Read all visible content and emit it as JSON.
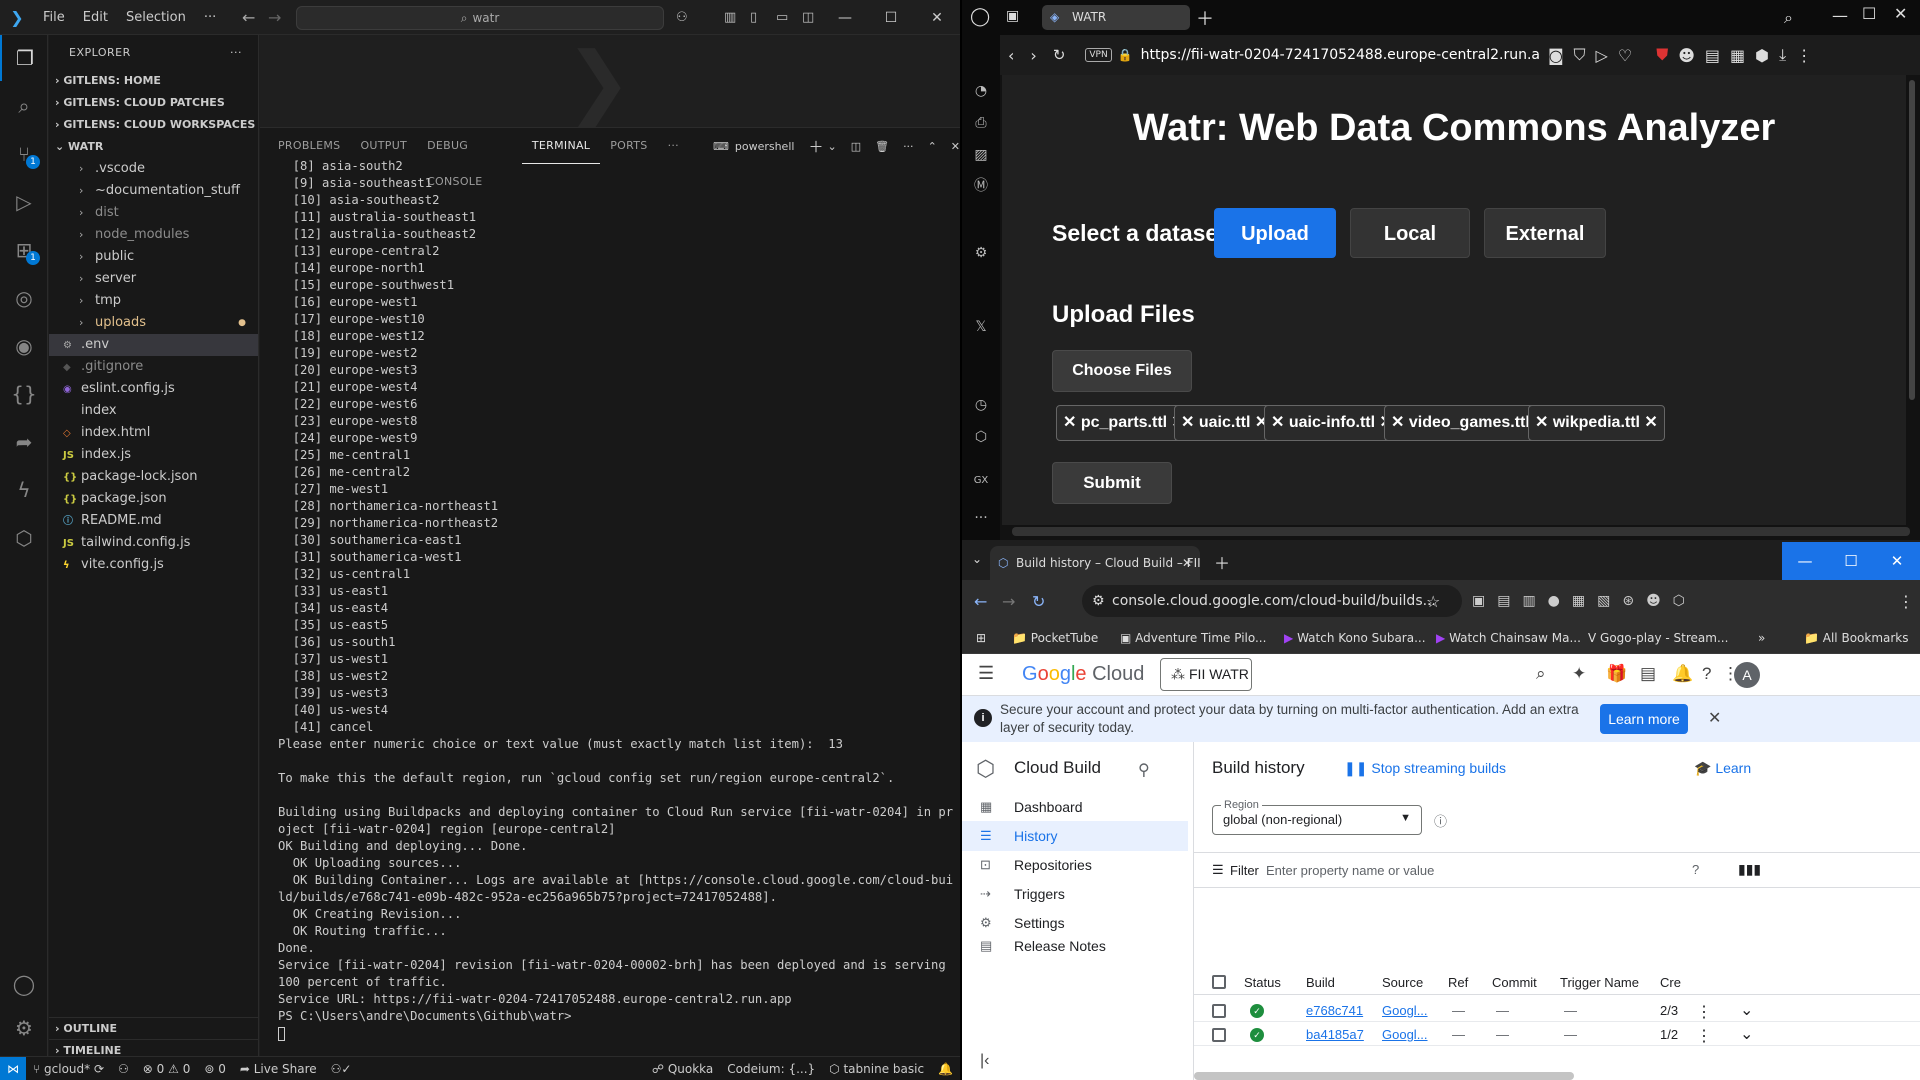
{
  "vscode": {
    "menu": [
      "File",
      "Edit",
      "Selection",
      "···"
    ],
    "search_text": "watr",
    "explorer_title": "EXPLORER",
    "sections": [
      "GITLENS: HOME",
      "GITLENS: CLOUD PATCHES",
      "GITLENS: CLOUD WORKSPACES"
    ],
    "root": "WATR",
    "files": [
      {
        "name": ".vscode",
        "folder": true
      },
      {
        "name": "~documentation_stuff",
        "folder": true
      },
      {
        "name": "dist",
        "folder": true,
        "dim": true
      },
      {
        "name": "node_modules",
        "folder": true,
        "dim": true
      },
      {
        "name": "public",
        "folder": true
      },
      {
        "name": "server",
        "folder": true
      },
      {
        "name": "tmp",
        "folder": true
      },
      {
        "name": "uploads",
        "folder": true,
        "modified": true
      },
      {
        "name": ".env",
        "icon": "gear",
        "selected": true
      },
      {
        "name": ".gitignore",
        "icon": "dot",
        "dim": true
      },
      {
        "name": "eslint.config.js",
        "icon": "eslint"
      },
      {
        "name": "index",
        "icon": "none"
      },
      {
        "name": "index.html",
        "icon": "html"
      },
      {
        "name": "index.js",
        "icon": "js"
      },
      {
        "name": "package-lock.json",
        "icon": "json"
      },
      {
        "name": "package.json",
        "icon": "json"
      },
      {
        "name": "README.md",
        "icon": "md"
      },
      {
        "name": "tailwind.config.js",
        "icon": "js"
      },
      {
        "name": "vite.config.js",
        "icon": "vite"
      }
    ],
    "bottom_sections": [
      "OUTLINE",
      "TIMELINE"
    ],
    "panel_tabs": [
      "PROBLEMS",
      "OUTPUT",
      "DEBUG CONSOLE",
      "TERMINAL",
      "PORTS",
      "···"
    ],
    "active_panel_tab": "TERMINAL",
    "shell": "powershell",
    "terminal_lines": [
      "  [8] asia-south2",
      "  [9] asia-southeast1",
      "  [10] asia-southeast2",
      "  [11] australia-southeast1",
      "  [12] australia-southeast2",
      "  [13] europe-central2",
      "  [14] europe-north1",
      "  [15] europe-southwest1",
      "  [16] europe-west1",
      "  [17] europe-west10",
      "  [18] europe-west12",
      "  [19] europe-west2",
      "  [20] europe-west3",
      "  [21] europe-west4",
      "  [22] europe-west6",
      "  [23] europe-west8",
      "  [24] europe-west9",
      "  [25] me-central1",
      "  [26] me-central2",
      "  [27] me-west1",
      "  [28] northamerica-northeast1",
      "  [29] northamerica-northeast2",
      "  [30] southamerica-east1",
      "  [31] southamerica-west1",
      "  [32] us-central1",
      "  [33] us-east1",
      "  [34] us-east4",
      "  [35] us-east5",
      "  [36] us-south1",
      "  [37] us-west1",
      "  [38] us-west2",
      "  [39] us-west3",
      "  [40] us-west4",
      "  [41] cancel",
      "Please enter numeric choice or text value (must exactly match list item):  13",
      "",
      "To make this the default region, run `gcloud config set run/region europe-central2`.",
      "",
      "Building using Buildpacks and deploying container to Cloud Run service [fii-watr-0204] in project [fii-watr-0204] region [europe-central2]",
      "OK Building and deploying... Done.",
      "  OK Uploading sources...",
      "  OK Building Container... Logs are available at [https://console.cloud.google.com/cloud-build/builds/e768c741-e09b-482c-952a-ec256a965b75?project=72417052488].",
      "  OK Creating Revision...",
      "  OK Routing traffic...",
      "Done.",
      "Service [fii-watr-0204] revision [fii-watr-0204-00002-brh] has been deployed and is serving 100 percent of traffic.",
      "Service URL: https://fii-watr-0204-72417052488.europe-central2.run.app",
      "PS C:\\Users\\andre\\Documents\\Github\\watr> "
    ],
    "status": {
      "branch": "gcloud*",
      "errors": "0",
      "warnings": "0",
      "ports": "0",
      "live_share": "Live Share",
      "quokka": "Quokka",
      "codeium": "Codeium: {...}",
      "tabnine": "tabnine basic"
    },
    "badges": {
      "scm": "1",
      "extensions": "1"
    }
  },
  "opera": {
    "tab_title": "WATR",
    "url": "https://fii-watr-0204-72417052488.europe-central2.run.a",
    "vpn": "VPN",
    "page": {
      "title": "Watr: Web Data Commons Analyzer",
      "select_label": "Select a dataset:",
      "buttons": [
        "Upload",
        "Local",
        "External"
      ],
      "upload_heading": "Upload Files",
      "choose_files": "Choose Files",
      "files": [
        "pc_parts.ttl",
        "uaic.ttl",
        "uaic-info.ttl",
        "video_games.ttl",
        "wikpedia.ttl"
      ],
      "submit": "Submit"
    }
  },
  "chrome": {
    "tab_title": "Build history – Cloud Build – FII",
    "url": "console.cloud.google.com/cloud-build/builds...",
    "bookmarks": [
      "PocketTube",
      "Adventure Time Pilo...",
      "Watch Kono Subara...",
      "Watch Chainsaw Ma...",
      "Gogo-play - Stream...",
      "All Bookmarks"
    ],
    "gcp": {
      "logo": "Google Cloud",
      "project": "FII WATR",
      "avatar": "A",
      "banner": "Secure your account and protect your data by turning on multi-factor authentication. Add an extra layer of security today.",
      "learn_more": "Learn more",
      "product": "Cloud Build",
      "nav": [
        "Dashboard",
        "History",
        "Repositories",
        "Triggers",
        "Settings",
        "Release Notes"
      ],
      "active_nav": "History",
      "page_title": "Build history",
      "stop_streaming": "Stop streaming builds",
      "learn": "Learn",
      "region_label": "Region",
      "region_value": "global (non-regional)",
      "filter": "Filter",
      "filter_placeholder": "Enter property name or value",
      "columns": [
        "Status",
        "Build",
        "Source",
        "Ref",
        "Commit",
        "Trigger Name",
        "Cre"
      ],
      "rows": [
        {
          "build": "e768c741",
          "source": "Googl...",
          "ref": "—",
          "commit": "—",
          "trigger": "—",
          "created": "2/3"
        },
        {
          "build": "ba4185a7",
          "source": "Googl...",
          "ref": "—",
          "commit": "—",
          "trigger": "—",
          "created": "1/2"
        }
      ]
    }
  }
}
